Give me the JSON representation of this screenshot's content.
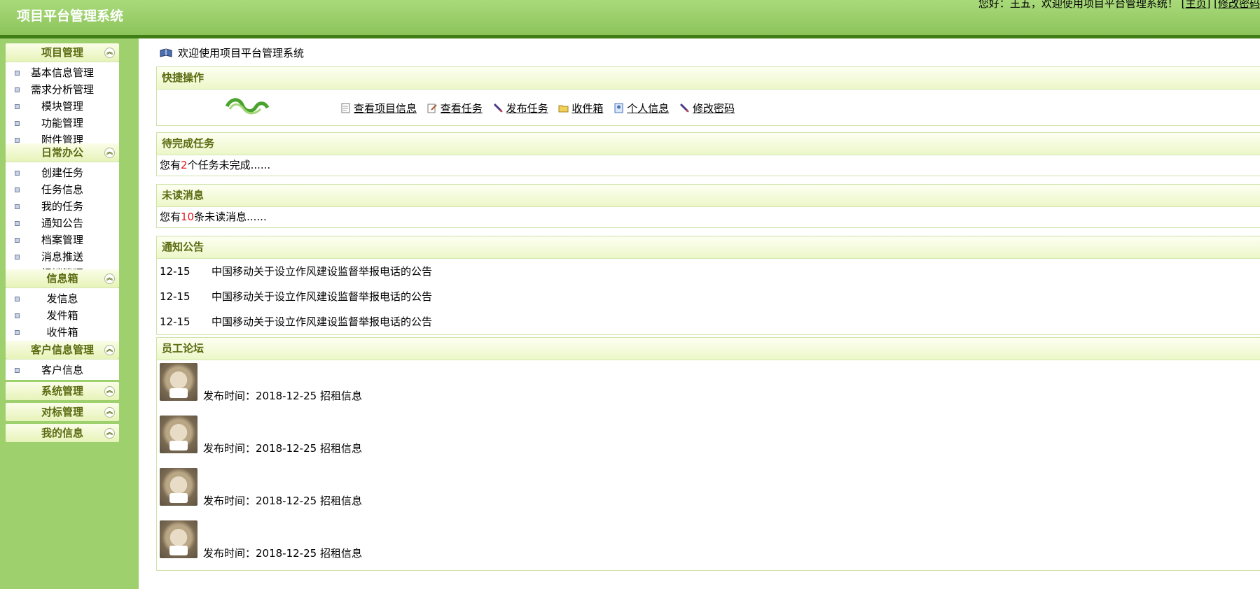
{
  "header": {
    "app_title": "项目平台管理系统",
    "greeting": "您好：王五，欢迎使用项目平台管理系统！",
    "link_home": "主页",
    "link_change_password": "修改密码"
  },
  "sidebar": {
    "groups": [
      {
        "title": "项目管理",
        "items": [
          "基本信息管理",
          "需求分析管理",
          "模块管理",
          "功能管理",
          "附件管理"
        ]
      },
      {
        "title": "日常办公",
        "items": [
          "创建任务",
          "任务信息",
          "我的任务",
          "通知公告",
          "档案管理",
          "消息推送",
          "报销管理"
        ]
      },
      {
        "title": "信息箱",
        "items": [
          "发信息",
          "发件箱",
          "收件箱"
        ]
      },
      {
        "title": "客户信息管理",
        "items": [
          "客户信息"
        ]
      },
      {
        "title": "系统管理",
        "items": []
      },
      {
        "title": "对标管理",
        "items": []
      },
      {
        "title": "我的信息",
        "items": []
      }
    ]
  },
  "main": {
    "welcome": "欢迎使用项目平台管理系统",
    "quick": {
      "title": "快捷操作",
      "links": [
        "查看项目信息",
        "查看任务",
        "发布任务",
        "收件箱",
        "个人信息",
        "修改密码"
      ]
    },
    "pending": {
      "title": "待完成任务",
      "prefix": "您有",
      "count": "2",
      "suffix": "个任务未完成......"
    },
    "unread": {
      "title": "未读消息",
      "prefix": "您有",
      "count": "10",
      "suffix": "条未读消息......"
    },
    "notices": {
      "title": "通知公告",
      "rows": [
        {
          "date": "12-15",
          "text": "中国移动关于设立作风建设监督举报电话的公告"
        },
        {
          "date": "12-15",
          "text": "中国移动关于设立作风建设监督举报电话的公告"
        },
        {
          "date": "12-15",
          "text": "中国移动关于设立作风建设监督举报电话的公告"
        }
      ]
    },
    "forum": {
      "title": "员工论坛",
      "rows": [
        {
          "text": "发布时间：2018-12-25  招租信息"
        },
        {
          "text": "发布时间：2018-12-25  招租信息"
        },
        {
          "text": "发布时间：2018-12-25  招租信息"
        },
        {
          "text": "发布时间：2018-12-25  招租信息"
        }
      ]
    }
  }
}
